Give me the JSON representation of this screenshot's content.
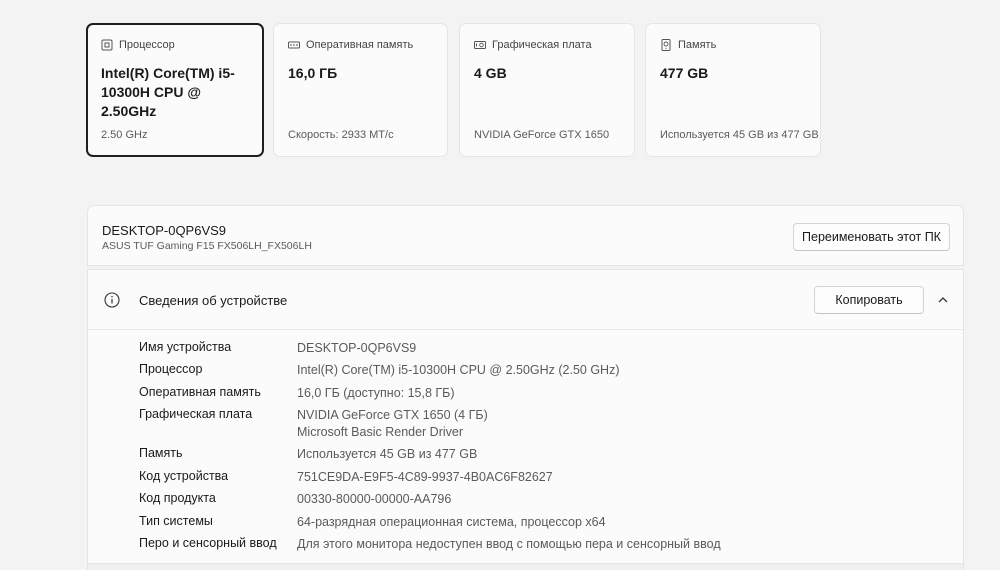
{
  "cards": [
    {
      "title": "Процессор",
      "icon": "processor-icon",
      "value": "Intel(R) Core(TM) i5-10300H CPU @ 2.50GHz",
      "sub": "2.50 GHz"
    },
    {
      "title": "Оперативная память",
      "icon": "ram-icon",
      "value": "16,0 ГБ",
      "sub": "Скорость: 2933 MT/c"
    },
    {
      "title": "Графическая плата",
      "icon": "gpu-icon",
      "value": "4 GB",
      "sub": "NVIDIA GeForce GTX 1650"
    },
    {
      "title": "Память",
      "icon": "storage-icon",
      "value": "477 GB",
      "sub": "Используется 45 GB из 477 GB"
    }
  ],
  "device": {
    "hostname": "DESKTOP-0QP6VS9",
    "model": "ASUS TUF Gaming F15 FX506LH_FX506LH",
    "rename_label": "Переименовать этот ПК"
  },
  "specs": {
    "title": "Сведения об устройстве",
    "copy_label": "Копировать",
    "rows": [
      {
        "key": "Имя устройства",
        "value": "DESKTOP-0QP6VS9"
      },
      {
        "key": "Процессор",
        "value": "Intel(R) Core(TM) i5-10300H CPU @ 2.50GHz (2.50 GHz)"
      },
      {
        "key": "Оперативная память",
        "value": "16,0 ГБ (доступно: 15,8 ГБ)"
      },
      {
        "key": "Графическая плата",
        "value": "NVIDIA GeForce GTX 1650 (4 ГБ)",
        "value2": "Microsoft Basic Render Driver"
      },
      {
        "key": "Память",
        "value": "Используется 45 GB из 477 GB"
      },
      {
        "key": "Код устройства",
        "value": "751CE9DA-E9F5-4C89-9937-4B0AC6F82627"
      },
      {
        "key": "Код продукта",
        "value": "00330-80000-00000-AA796"
      },
      {
        "key": "Тип системы",
        "value": "64-разрядная операционная система, процессор x64"
      },
      {
        "key": "Перо и сенсорный ввод",
        "value": "Для этого монитора недоступен ввод с помощью пера и сенсорный ввод"
      }
    ]
  }
}
